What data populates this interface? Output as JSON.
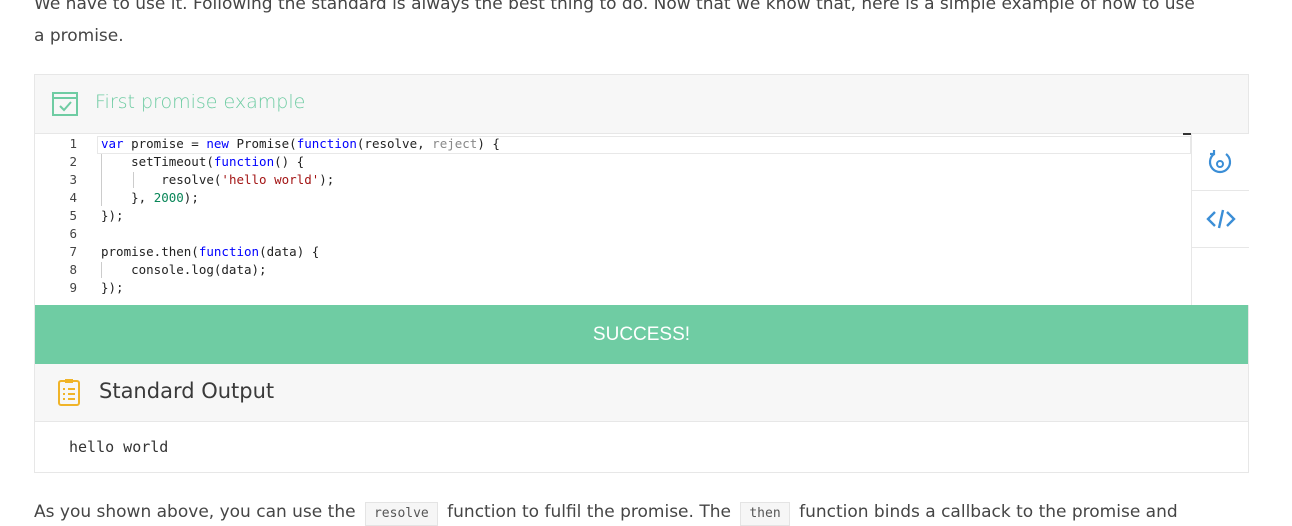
{
  "intro_paragraph": {
    "line1": "We have to use it. Following the standard is always the best thing to do. Now that we know that, here is a simple example of how to use",
    "line2": "a promise."
  },
  "widget": {
    "title": "First promise example",
    "title_icon": "checkbox-calendar-icon",
    "accent_color": "#6fcca3",
    "code_lines": [
      {
        "num": "1",
        "text": "var promise = new Promise(function(resolve, reject) {"
      },
      {
        "num": "2",
        "text": "    setTimeout(function() {"
      },
      {
        "num": "3",
        "text": "        resolve('hello world');"
      },
      {
        "num": "4",
        "text": "    }, 2000);"
      },
      {
        "num": "5",
        "text": "});"
      },
      {
        "num": "6",
        "text": ""
      },
      {
        "num": "7",
        "text": "promise.then(function(data) {"
      },
      {
        "num": "8",
        "text": "    console.log(data);"
      },
      {
        "num": "9",
        "text": "});"
      }
    ],
    "tools": [
      {
        "name": "reset-icon"
      },
      {
        "name": "code-icon"
      }
    ],
    "status": "SUCCESS!",
    "output_title": "Standard Output",
    "output_icon": "clipboard-list-icon",
    "output_text": "hello world"
  },
  "after_paragraph": {
    "part1": "As you shown above, you can use the",
    "code1": "resolve",
    "part2": "function to fulfil the promise. The",
    "code2": "then",
    "part3": "function binds a callback to the promise and"
  }
}
